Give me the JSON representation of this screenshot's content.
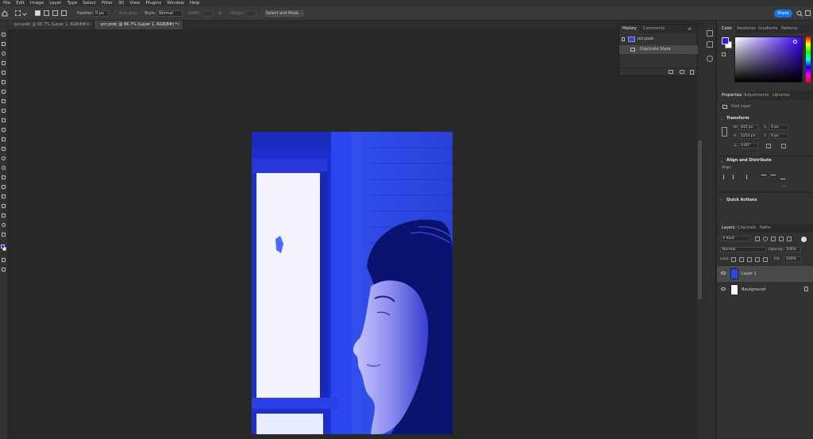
{
  "menu": [
    "File",
    "Edit",
    "Image",
    "Layer",
    "Type",
    "Select",
    "Filter",
    "3D",
    "View",
    "Plugins",
    "Window",
    "Help"
  ],
  "options": {
    "feather_label": "Feather:",
    "feather_value": "0 px",
    "antialias_label": "Anti-alias",
    "style_label": "Style:",
    "style_value": "Normal",
    "width_label": "Width:",
    "height_label": "Height:",
    "select_mask_button": "Select and Mask...",
    "share_button": "Share"
  },
  "tabs": [
    {
      "label": "pcr.psdc @ 66.7% (Layer 1, RGB/8#)",
      "active": false
    },
    {
      "label": "pcr.psdc @ 66.7% (Layer 1, RGB/8#) *",
      "active": true
    }
  ],
  "history": {
    "tabs": [
      "History",
      "Comments"
    ],
    "snapshot": "pcr.psdc",
    "state": "Duplicate State"
  },
  "color_panel": {
    "tabs": [
      "Color",
      "Swatches",
      "Gradients",
      "Patterns"
    ],
    "foreground": "#2b1bf0",
    "background": "#ffffff"
  },
  "properties": {
    "tabs": [
      "Properties",
      "Adjustments",
      "Libraries"
    ],
    "layer_kind": "Pixel Layer",
    "transform_title": "Transform",
    "w_label": "W",
    "w_value": "835 px",
    "x_label": "X",
    "x_value": "0 px",
    "h_label": "H",
    "h_value": "1253 px",
    "y_label": "Y",
    "y_value": "0 px",
    "angle_value": "0.00°",
    "align_title": "Align and Distribute",
    "align_label": "Align:",
    "quick_actions": "Quick Actions"
  },
  "layers_panel": {
    "tabs": [
      "Layers",
      "Channels",
      "Paths"
    ],
    "filter_kind": "Kind",
    "blend_mode": "Normal",
    "opacity_label": "Opacity:",
    "opacity_value": "100%",
    "lock_label": "Lock:",
    "fill_label": "Fill:",
    "fill_value": "100%",
    "layers": [
      {
        "name": "Layer 1",
        "selected": true
      },
      {
        "name": "Background",
        "selected": false
      }
    ]
  }
}
